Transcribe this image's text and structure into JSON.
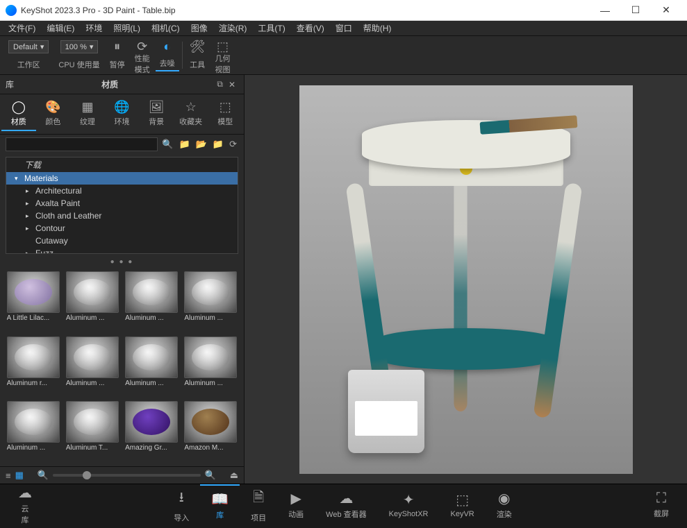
{
  "window": {
    "title": "KeyShot 2023.3 Pro  - 3D Paint - Table.bip"
  },
  "menu": [
    "文件(F)",
    "编辑(E)",
    "环境",
    "照明(L)",
    "相机(C)",
    "图像",
    "渲染(R)",
    "工具(T)",
    "查看(V)",
    "窗口",
    "帮助(H)"
  ],
  "toolbar": {
    "preset": "Default",
    "zoom": "100 %",
    "workspace": "工作区",
    "cpu": "CPU 使用量",
    "pause": "暂停",
    "perf": "性能\n模式",
    "denoise": "去噪",
    "tools": "工具",
    "geom": "几何\n视图"
  },
  "library": {
    "header_left": "库",
    "header_center": "材质",
    "tabs": [
      {
        "label": "材质",
        "active": true
      },
      {
        "label": "颜色"
      },
      {
        "label": "纹理"
      },
      {
        "label": "环境"
      },
      {
        "label": "背景"
      },
      {
        "label": "收藏夹"
      },
      {
        "label": "模型"
      }
    ],
    "tree": [
      {
        "label": "下载",
        "level": 1,
        "italic": true
      },
      {
        "label": "Materials",
        "level": 1,
        "selected": true,
        "caret": "▾"
      },
      {
        "label": "Architectural",
        "level": 2,
        "caret": "▸"
      },
      {
        "label": "Axalta Paint",
        "level": 2,
        "caret": "▸"
      },
      {
        "label": "Cloth and Leather",
        "level": 2,
        "caret": "▸"
      },
      {
        "label": "Contour",
        "level": 2,
        "caret": "▸"
      },
      {
        "label": "Cutaway",
        "level": 2
      },
      {
        "label": "Fuzz",
        "level": 2,
        "caret": "▸"
      }
    ],
    "thumbs": [
      {
        "label": "A Little Lilac...",
        "cls": "lilac"
      },
      {
        "label": "Aluminum ..."
      },
      {
        "label": "Aluminum ..."
      },
      {
        "label": "Aluminum ..."
      },
      {
        "label": "Aluminum r..."
      },
      {
        "label": "Aluminum ..."
      },
      {
        "label": "Aluminum ..."
      },
      {
        "label": "Aluminum ..."
      },
      {
        "label": "Aluminum ..."
      },
      {
        "label": "Aluminum T..."
      },
      {
        "label": "Amazing Gr...",
        "cls": "purple"
      },
      {
        "label": "Amazon M...",
        "cls": "bronze"
      }
    ]
  },
  "bottombar": {
    "left": [
      {
        "label": "云\n库",
        "name": "cloud-library"
      }
    ],
    "mid": [
      {
        "label": "导入",
        "name": "import"
      },
      {
        "label": "库",
        "name": "library",
        "active": true
      },
      {
        "label": "项目",
        "name": "project"
      },
      {
        "label": "动画",
        "name": "animation"
      },
      {
        "label": "Web 查看器",
        "name": "web-viewer"
      },
      {
        "label": "KeyShotXR",
        "name": "keyshotxr"
      },
      {
        "label": "KeyVR",
        "name": "keyvr"
      },
      {
        "label": "渲染",
        "name": "render"
      }
    ],
    "right": [
      {
        "label": "截屏",
        "name": "screenshot"
      }
    ]
  }
}
